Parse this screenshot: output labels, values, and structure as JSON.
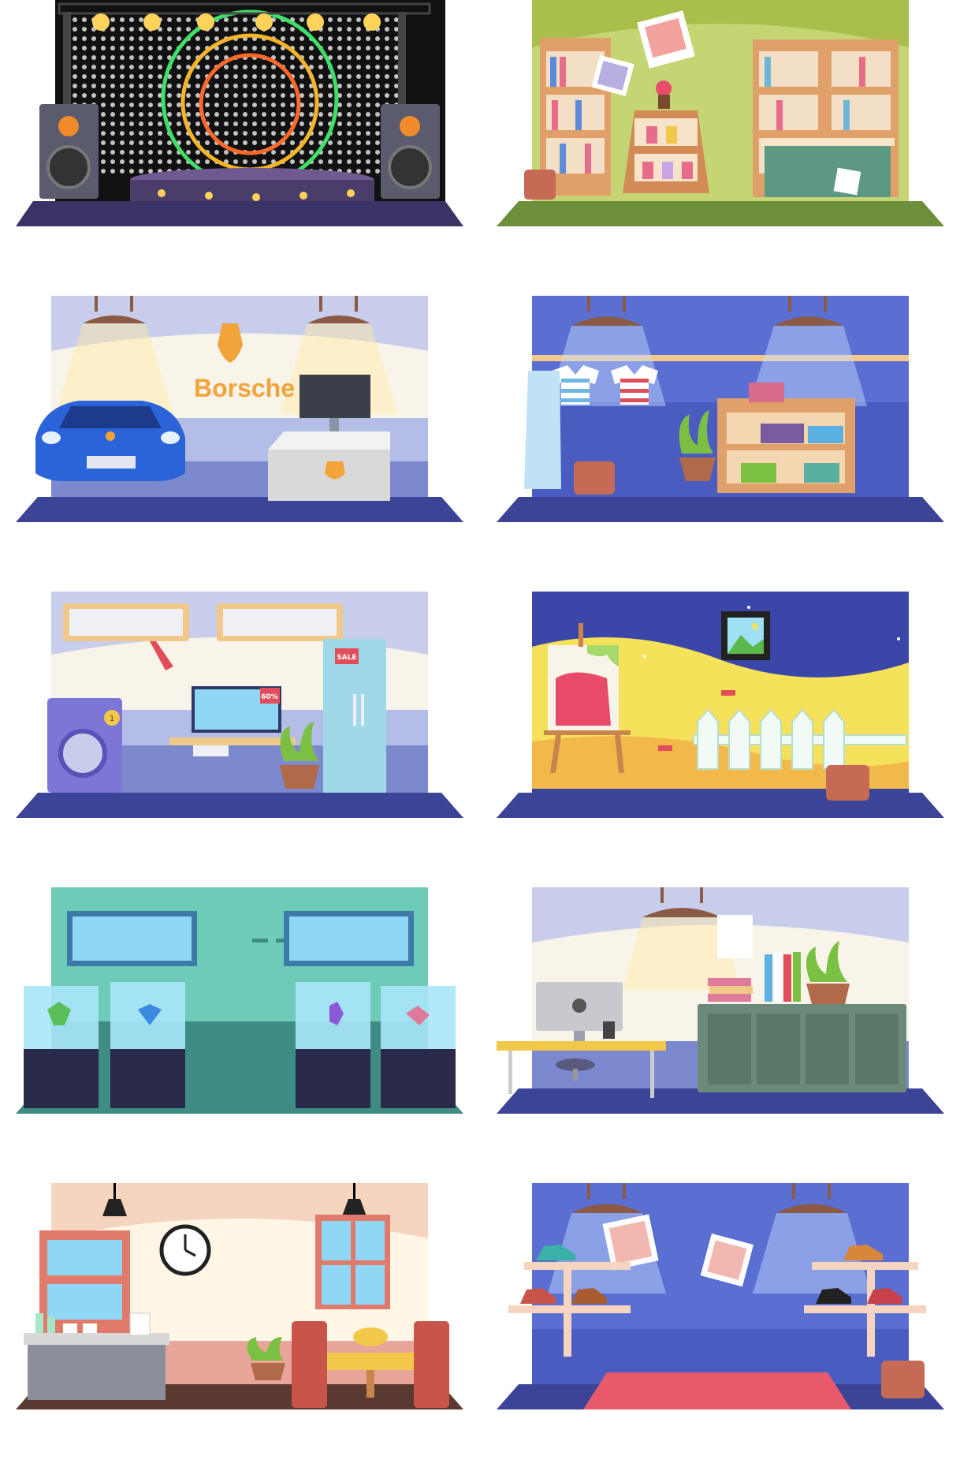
{
  "scenes": [
    {
      "id": "stage",
      "label": ""
    },
    {
      "id": "bookstore",
      "label": ""
    },
    {
      "id": "car-showroom",
      "label": "",
      "brand_text": "Borsche"
    },
    {
      "id": "clothing-store",
      "label": ""
    },
    {
      "id": "appliance-store",
      "label": "",
      "discount_text": "60%",
      "sale_text": "SALE",
      "badge_text": "1"
    },
    {
      "id": "art-studio",
      "label": ""
    },
    {
      "id": "jewelry-store",
      "label": ""
    },
    {
      "id": "office",
      "label": ""
    },
    {
      "id": "cafe",
      "label": ""
    },
    {
      "id": "shoe-store",
      "label": ""
    }
  ],
  "colors": {
    "floor_navy": "#3b4497",
    "wall_blue": "#5a6fd1",
    "lamp_brown": "#8b5a44",
    "accent_orange": "#f2a33a",
    "teal_wall": "#6ecbb7",
    "cream_wall": "#fff6e6"
  }
}
